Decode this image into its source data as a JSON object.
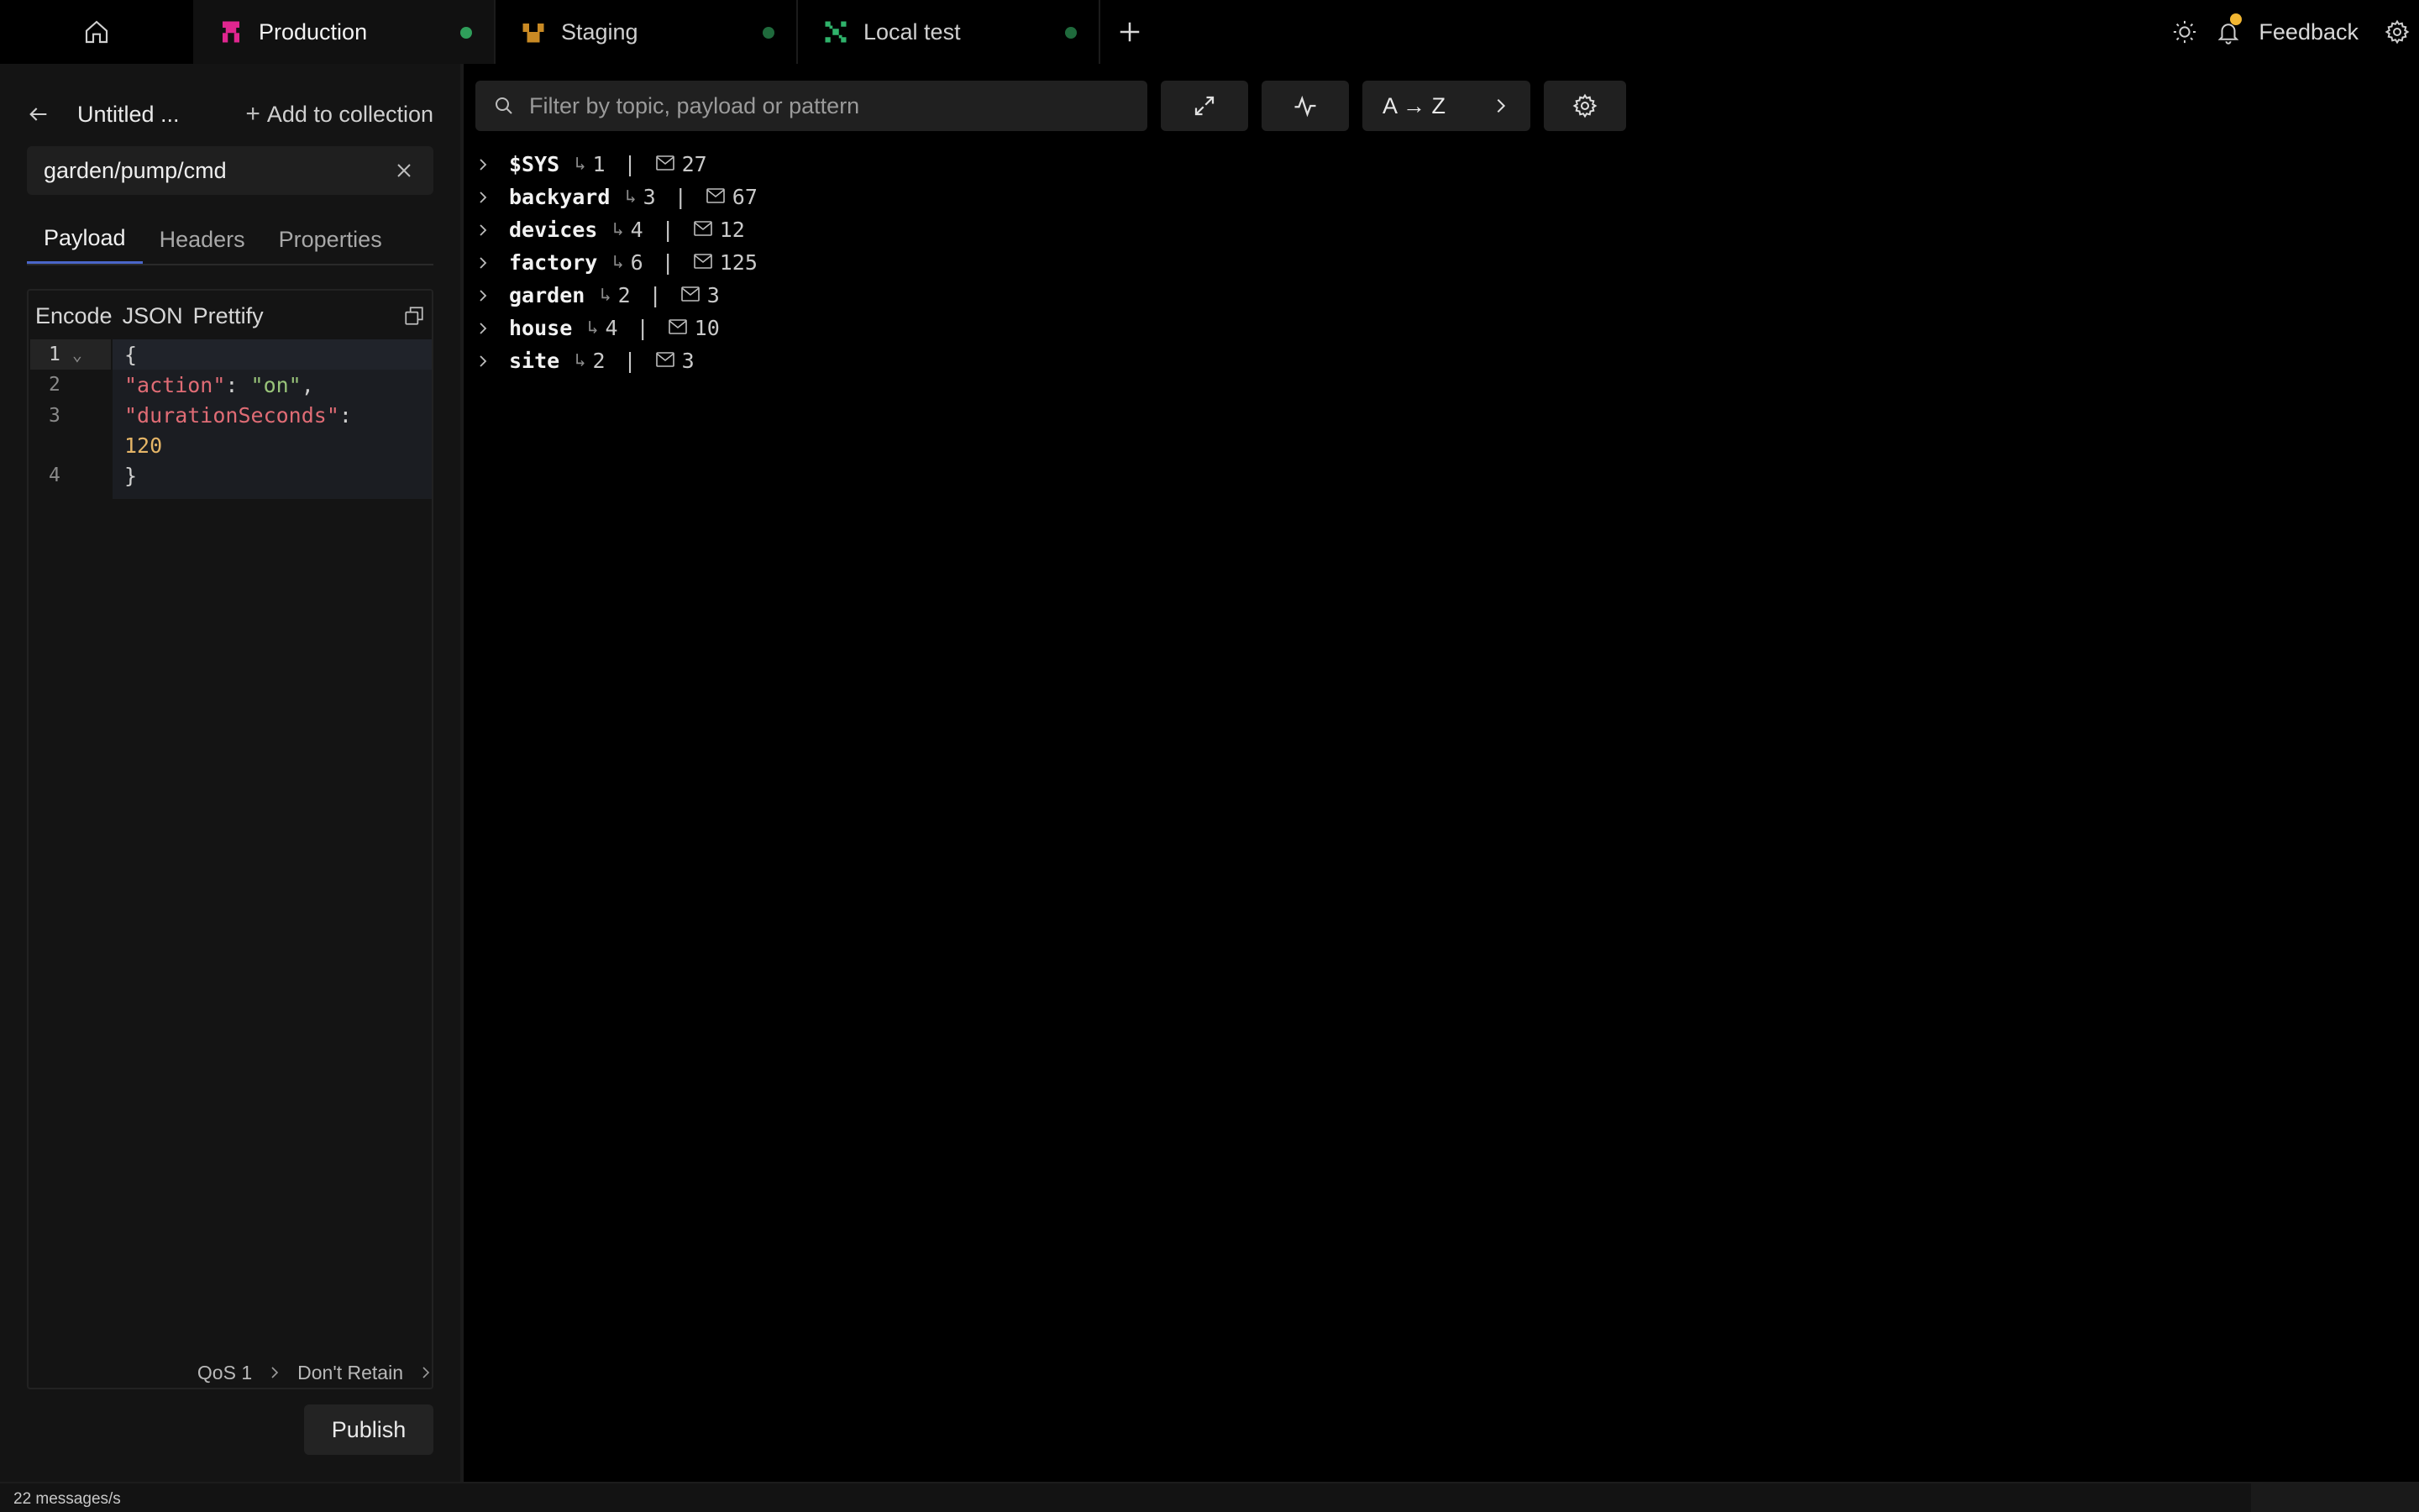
{
  "tabs": [
    {
      "label": "Production",
      "icon": "production-icon",
      "color": "#e0268f",
      "active": true
    },
    {
      "label": "Staging",
      "icon": "staging-icon",
      "color": "#c98a24",
      "active": false
    },
    {
      "label": "Local test",
      "icon": "local-test-icon",
      "color": "#2fb36b",
      "active": false
    }
  ],
  "topbar": {
    "feedback_label": "Feedback"
  },
  "left": {
    "title": "Untitled ...",
    "add_collection_label": "Add to collection",
    "topic_value": "garden/pump/cmd",
    "tabs": [
      "Payload",
      "Headers",
      "Properties"
    ],
    "editor_toolbar": [
      "Encode",
      "JSON",
      "Prettify"
    ],
    "line_numbers": [
      "1",
      "2",
      "3",
      "4"
    ],
    "code": {
      "line1": "{",
      "key_action": "\"action\"",
      "val_action": "\"on\"",
      "key_duration": "\"durationSeconds\"",
      "val_duration": "120",
      "line_last": "}"
    },
    "qos_label": "QoS 1",
    "retain_label": "Don't Retain",
    "publish_label": "Publish"
  },
  "main": {
    "search_placeholder": "Filter by topic, payload or pattern",
    "sort_label": "A → Z",
    "tree": [
      {
        "name": "$SYS",
        "subtopics": "1",
        "messages": "27"
      },
      {
        "name": "backyard",
        "subtopics": "3",
        "messages": "67"
      },
      {
        "name": "devices",
        "subtopics": "4",
        "messages": "12"
      },
      {
        "name": "factory",
        "subtopics": "6",
        "messages": "125"
      },
      {
        "name": "garden",
        "subtopics": "2",
        "messages": "3"
      },
      {
        "name": "house",
        "subtopics": "4",
        "messages": "10"
      },
      {
        "name": "site",
        "subtopics": "2",
        "messages": "3"
      }
    ]
  },
  "status": {
    "rate": "22 messages/s"
  },
  "colors": {
    "accent_tab_underline": "#4a66c9",
    "notification": "#f2b632",
    "connected": "#2f9e5a"
  }
}
